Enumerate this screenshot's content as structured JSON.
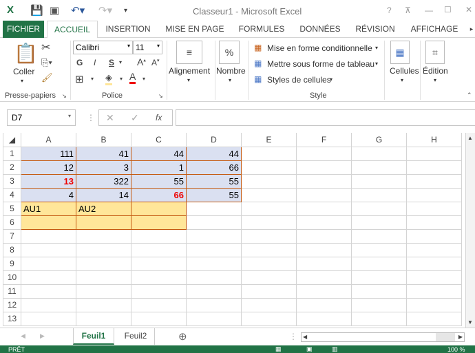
{
  "window": {
    "title": "Classeur1 - Microsoft Excel",
    "help": "?",
    "minimize": "—",
    "maximize": "☐",
    "close": "✕"
  },
  "tabs": [
    "FICHIER",
    "ACCUEIL",
    "INSERTION",
    "MISE EN PAGE",
    "FORMULES",
    "DONNÉES",
    "RÉVISION",
    "AFFICHAGE"
  ],
  "ribbon": {
    "clipboard": {
      "paste": "Coller",
      "group": "Presse-papiers"
    },
    "font": {
      "name": "Calibri",
      "size": "11",
      "bold": "G",
      "italic": "I",
      "underline": "S",
      "group": "Police"
    },
    "alignment": {
      "label": "Alignement"
    },
    "number": {
      "label": "Nombre",
      "icon": "%"
    },
    "style": {
      "cond": "Mise en forme conditionnelle",
      "table": "Mettre sous forme de tableau",
      "cells": "Styles de cellules",
      "group": "Style"
    },
    "cells": {
      "label": "Cellules"
    },
    "editing": {
      "label": "Édition"
    }
  },
  "formula_bar": {
    "name_box": "D7",
    "fx": "fx",
    "value": ""
  },
  "columns": [
    "A",
    "B",
    "C",
    "D",
    "E",
    "F",
    "G",
    "H"
  ],
  "rows": [
    {
      "n": "1",
      "cells": [
        "111",
        "41",
        "44",
        "44"
      ]
    },
    {
      "n": "2",
      "cells": [
        "12",
        "3",
        "1",
        "66"
      ]
    },
    {
      "n": "3",
      "cells": [
        "13",
        "322",
        "55",
        "55"
      ]
    },
    {
      "n": "4",
      "cells": [
        "4",
        "14",
        "66",
        "55"
      ]
    },
    {
      "n": "5",
      "cells": [
        "AU1",
        "AU2",
        ""
      ]
    },
    {
      "n": "6",
      "cells": [
        "",
        "",
        ""
      ]
    },
    {
      "n": "7"
    },
    {
      "n": "8"
    },
    {
      "n": "9"
    },
    {
      "n": "10"
    },
    {
      "n": "11"
    },
    {
      "n": "12"
    },
    {
      "n": "13"
    }
  ],
  "sheets": [
    "Feuil1",
    "Feuil2"
  ],
  "status": {
    "ready": "PRÊT",
    "zoom": "100 %"
  },
  "colors": {
    "accent": "#217346",
    "highlight_red": "#e00000"
  }
}
